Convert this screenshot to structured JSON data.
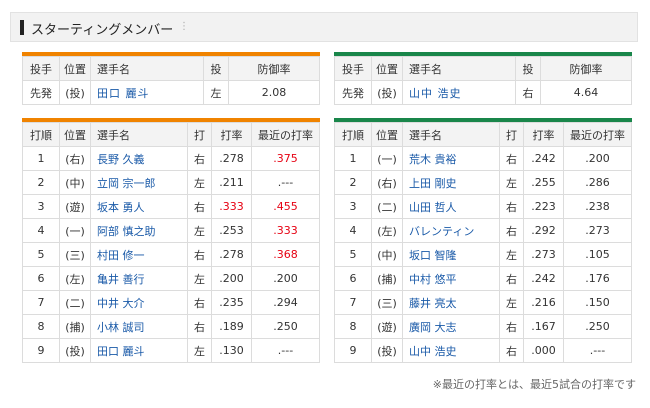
{
  "header": {
    "title": "スターティングメンバー",
    "dots": "⋮"
  },
  "colors": {
    "team1": "#f08300",
    "team2": "#19864a",
    "highlight": "#e60012"
  },
  "pitcher_headers": {
    "role": "投手",
    "pos": "位置",
    "name": "選手名",
    "throw": "投",
    "era": "防御率"
  },
  "pitchers": [
    {
      "role": "先発",
      "pos": "(投)",
      "name": "田口 麗斗",
      "throw": "左",
      "era": "2.08"
    },
    {
      "role": "先発",
      "pos": "(投)",
      "name": "山中 浩史",
      "throw": "右",
      "era": "4.64"
    }
  ],
  "lineup_headers": {
    "order": "打順",
    "pos": "位置",
    "name": "選手名",
    "bat": "打",
    "avg": "打率",
    "recent": "最近の打率"
  },
  "team1_lineup": [
    {
      "order": "1",
      "pos": "(右)",
      "name": "長野 久義",
      "bat": "右",
      "avg": ".278",
      "recent": ".375",
      "avg_hi": false,
      "recent_hi": true
    },
    {
      "order": "2",
      "pos": "(中)",
      "name": "立岡 宗一郎",
      "bat": "左",
      "avg": ".211",
      "recent": ".---",
      "avg_hi": false,
      "recent_hi": false
    },
    {
      "order": "3",
      "pos": "(遊)",
      "name": "坂本 勇人",
      "bat": "右",
      "avg": ".333",
      "recent": ".455",
      "avg_hi": true,
      "recent_hi": true
    },
    {
      "order": "4",
      "pos": "(一)",
      "name": "阿部 慎之助",
      "bat": "左",
      "avg": ".253",
      "recent": ".333",
      "avg_hi": false,
      "recent_hi": true
    },
    {
      "order": "5",
      "pos": "(三)",
      "name": "村田 修一",
      "bat": "右",
      "avg": ".278",
      "recent": ".368",
      "avg_hi": false,
      "recent_hi": true
    },
    {
      "order": "6",
      "pos": "(左)",
      "name": "亀井 善行",
      "bat": "左",
      "avg": ".200",
      "recent": ".200",
      "avg_hi": false,
      "recent_hi": false
    },
    {
      "order": "7",
      "pos": "(二)",
      "name": "中井 大介",
      "bat": "右",
      "avg": ".235",
      "recent": ".294",
      "avg_hi": false,
      "recent_hi": false
    },
    {
      "order": "8",
      "pos": "(捕)",
      "name": "小林 誠司",
      "bat": "右",
      "avg": ".189",
      "recent": ".250",
      "avg_hi": false,
      "recent_hi": false
    },
    {
      "order": "9",
      "pos": "(投)",
      "name": "田口 麗斗",
      "bat": "左",
      "avg": ".130",
      "recent": ".---",
      "avg_hi": false,
      "recent_hi": false
    }
  ],
  "team2_lineup": [
    {
      "order": "1",
      "pos": "(一)",
      "name": "荒木 貴裕",
      "bat": "右",
      "avg": ".242",
      "recent": ".200",
      "avg_hi": false,
      "recent_hi": false
    },
    {
      "order": "2",
      "pos": "(右)",
      "name": "上田 剛史",
      "bat": "左",
      "avg": ".255",
      "recent": ".286",
      "avg_hi": false,
      "recent_hi": false
    },
    {
      "order": "3",
      "pos": "(二)",
      "name": "山田 哲人",
      "bat": "右",
      "avg": ".223",
      "recent": ".238",
      "avg_hi": false,
      "recent_hi": false
    },
    {
      "order": "4",
      "pos": "(左)",
      "name": "バレンティン",
      "bat": "右",
      "avg": ".292",
      "recent": ".273",
      "avg_hi": false,
      "recent_hi": false
    },
    {
      "order": "5",
      "pos": "(中)",
      "name": "坂口 智隆",
      "bat": "左",
      "avg": ".273",
      "recent": ".105",
      "avg_hi": false,
      "recent_hi": false
    },
    {
      "order": "6",
      "pos": "(捕)",
      "name": "中村 悠平",
      "bat": "右",
      "avg": ".242",
      "recent": ".176",
      "avg_hi": false,
      "recent_hi": false
    },
    {
      "order": "7",
      "pos": "(三)",
      "name": "藤井 亮太",
      "bat": "左",
      "avg": ".216",
      "recent": ".150",
      "avg_hi": false,
      "recent_hi": false
    },
    {
      "order": "8",
      "pos": "(遊)",
      "name": "廣岡 大志",
      "bat": "右",
      "avg": ".167",
      "recent": ".250",
      "avg_hi": false,
      "recent_hi": false
    },
    {
      "order": "9",
      "pos": "(投)",
      "name": "山中 浩史",
      "bat": "右",
      "avg": ".000",
      "recent": ".---",
      "avg_hi": false,
      "recent_hi": false
    }
  ],
  "footnote": "※最近の打率とは、最近5試合の打率です"
}
